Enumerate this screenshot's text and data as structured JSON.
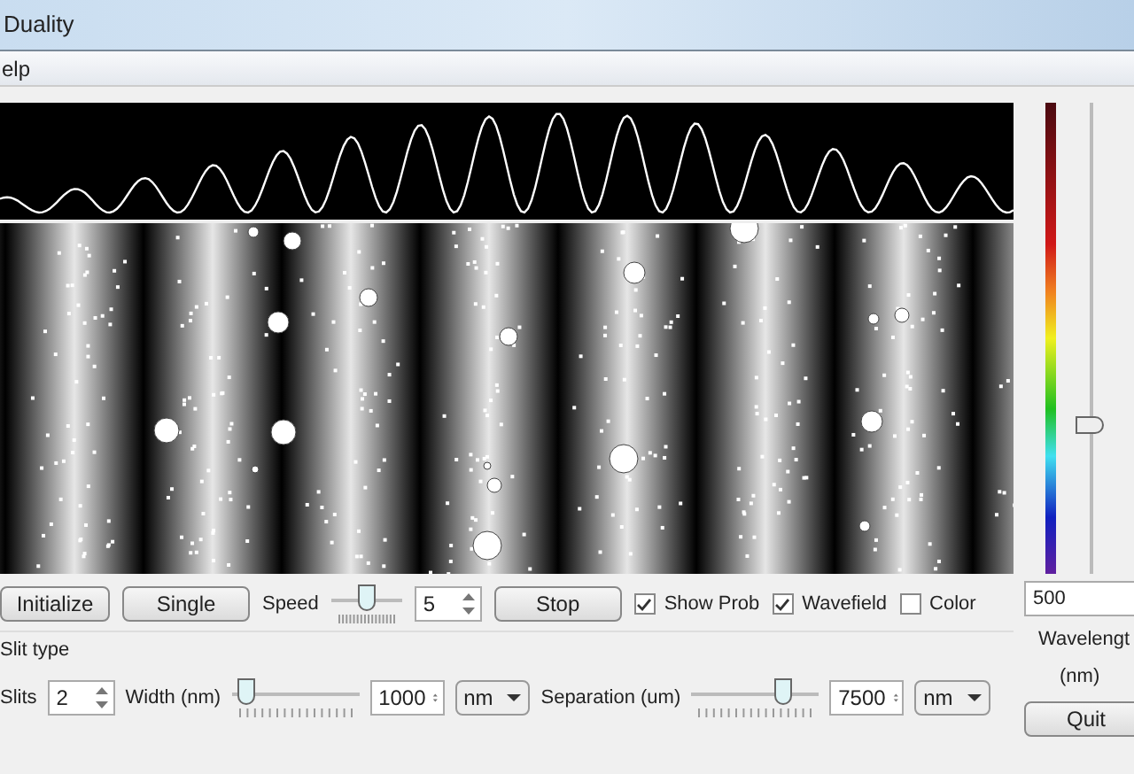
{
  "window": {
    "title": "Duality"
  },
  "menu": [
    "elp"
  ],
  "controls": {
    "initialize": "Initialize",
    "single": "Single",
    "speed": {
      "label": "Speed",
      "level": 0.5,
      "value": "5"
    },
    "stop": "Stop",
    "checks": [
      {
        "label": "Show Prob",
        "checked": true
      },
      {
        "label": "Wavefield",
        "checked": true
      },
      {
        "label": "Color",
        "checked": false
      }
    ]
  },
  "slit_group": {
    "title": "Slit type",
    "slits": {
      "label": "Slits",
      "value": "2"
    },
    "width": {
      "label": "Width (nm)",
      "level": 0.05,
      "value": "1000",
      "unit": "nm"
    },
    "separation": {
      "label": "Separation (um)",
      "level": 0.75,
      "value": "7500",
      "unit": "nm"
    }
  },
  "wavelength": {
    "level": 0.31,
    "value": "500",
    "label": "Wavelengt",
    "unit": "(nm)"
  },
  "quit": "Quit"
}
